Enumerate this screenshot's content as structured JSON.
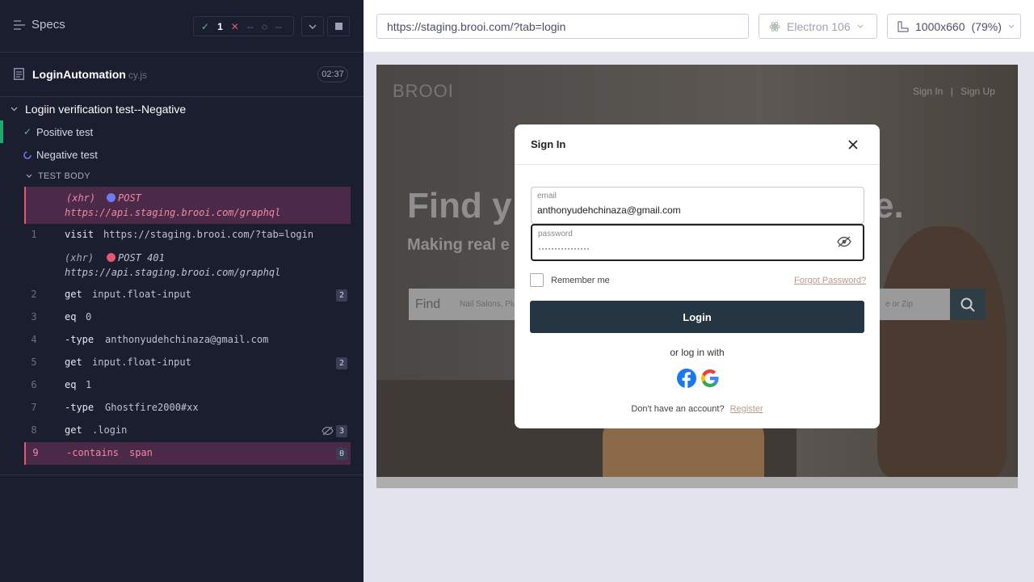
{
  "reporter": {
    "specs_label": "Specs",
    "stats": {
      "passed": "1",
      "failed": "--",
      "pending": "--"
    },
    "file": {
      "name": "LoginAutomation",
      "ext": "cy.js",
      "duration": "02:37"
    },
    "suite": "Logiin verification test--Negative",
    "tests": [
      {
        "label": "Positive test",
        "state": "passed"
      },
      {
        "label": "Negative test",
        "state": "running"
      }
    ],
    "section": "TEST BODY",
    "commands": [
      {
        "ln": "",
        "name": "(xhr)",
        "msg": "POST",
        "msg2": "https://api.staging.brooi.com/graphql",
        "badge": ""
      },
      {
        "ln": "1",
        "name": "visit",
        "msg": "https://staging.brooi.com/?tab=login",
        "badge": ""
      },
      {
        "ln": "",
        "name": "(xhr)",
        "msg": "POST 401",
        "msg2": "https://api.staging.brooi.com/graphql",
        "badge": ""
      },
      {
        "ln": "2",
        "name": "get",
        "msg": "input.float-input",
        "badge": "2"
      },
      {
        "ln": "3",
        "name": "eq",
        "msg": "0",
        "badge": ""
      },
      {
        "ln": "4",
        "name": "-type",
        "msg": "anthonyudehchinaza@gmail.com",
        "badge": ""
      },
      {
        "ln": "5",
        "name": "get",
        "msg": "input.float-input",
        "badge": "2"
      },
      {
        "ln": "6",
        "name": "eq",
        "msg": "1",
        "badge": ""
      },
      {
        "ln": "7",
        "name": "-type",
        "msg": "Ghostfire2000#xx",
        "badge": ""
      },
      {
        "ln": "8",
        "name": "get",
        "msg": ".login",
        "badge": "3"
      },
      {
        "ln": "9",
        "name": "-contains",
        "msg": "span",
        "badge": "0"
      }
    ]
  },
  "toolbar": {
    "url": "https://staging.brooi.com/?tab=login",
    "browser": "Electron 106",
    "viewport": "1000x660",
    "zoom": "(79%)"
  },
  "aut": {
    "logo": "BROOI",
    "nav": {
      "signin": "Sign In",
      "sep": "|",
      "signup": "Sign Up"
    },
    "hero_left": "Find y",
    "hero_right": "e.",
    "hero_sub": "Making real e",
    "search_find": "Find",
    "search_placeholder": "Nail Salons, Plu",
    "search_placeholder2": "e or Zip"
  },
  "modal": {
    "title": "Sign In",
    "email_label": "email",
    "email_value": "anthonyudehchinaza@gmail.com",
    "password_label": "password",
    "password_value": "················",
    "remember": "Remember me",
    "forgot": "Forgot Password?",
    "login": "Login",
    "or_login": "or log in with",
    "no_account": "Don't have an account?",
    "register": "Register"
  },
  "colors": {
    "pass": "#1fa971",
    "fail": "#e45770",
    "running": "#6c7df2",
    "modal_button": "#253542"
  }
}
